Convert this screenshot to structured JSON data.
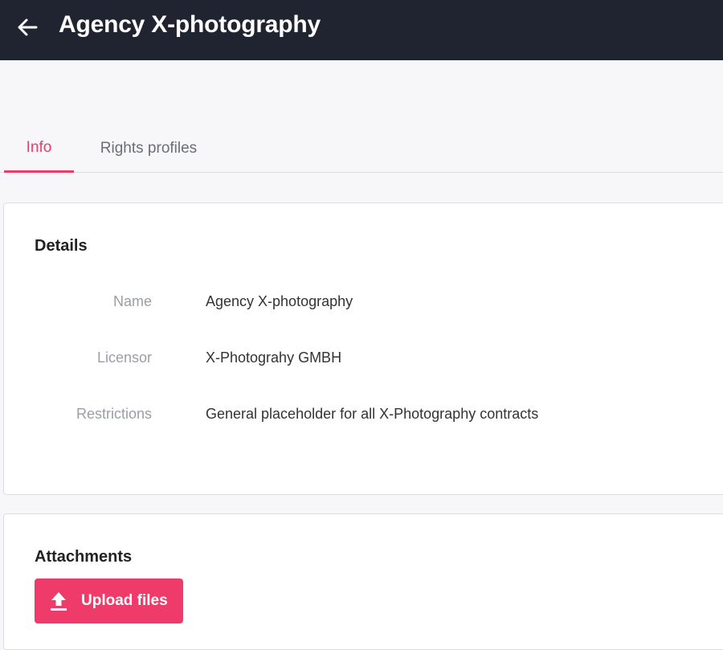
{
  "header": {
    "title": "Agency X-photography",
    "back_icon": "arrow-left-icon"
  },
  "tabs": [
    {
      "label": "Info",
      "active": true
    },
    {
      "label": "Rights profiles",
      "active": false
    }
  ],
  "details": {
    "title": "Details",
    "fields": [
      {
        "label": "Name",
        "value": "Agency X-photography"
      },
      {
        "label": "Licensor",
        "value": "X-Photograhy GMBH"
      },
      {
        "label": "Restrictions",
        "value": "General placeholder for all X-Photography contracts"
      }
    ]
  },
  "attachments": {
    "title": "Attachments",
    "upload_label": "Upload files",
    "upload_icon": "upload-icon"
  },
  "colors": {
    "accent": "#ef3b6a",
    "topbar": "#1f2430",
    "background": "#f7f7f9"
  }
}
